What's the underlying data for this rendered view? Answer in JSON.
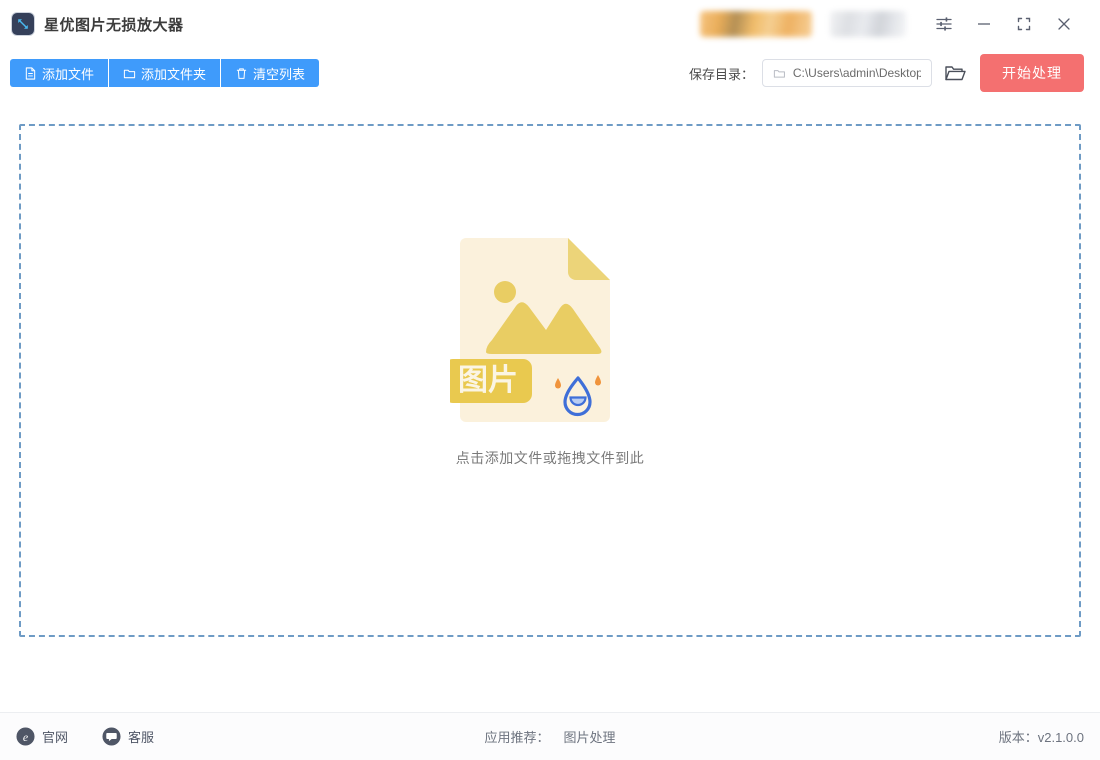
{
  "window": {
    "title": "星优图片无损放大器",
    "app_icon": "resize-arrows-icon",
    "controls": {
      "settings": "settings-sliders-icon",
      "minimize": "minimize-icon",
      "maximize": "maximize-icon",
      "close": "close-icon"
    }
  },
  "toolbar": {
    "buttons": [
      {
        "label": "添加文件",
        "icon": "file-icon"
      },
      {
        "label": "添加文件夹",
        "icon": "folder-icon"
      },
      {
        "label": "清空列表",
        "icon": "trash-icon"
      }
    ],
    "save_dir_label": "保存目录：",
    "save_dir_value": "C:\\Users\\admin\\Desktop",
    "save_dir_placeholder": "C:\\Users\\admin\\Desktop",
    "browse_icon": "open-folder-icon",
    "start_button": "开始处理"
  },
  "dropzone": {
    "hint": "点击添加文件或拖拽文件到此",
    "illustration_badge": "图片"
  },
  "footer": {
    "links": [
      {
        "label": "官网",
        "icon": "browser-e-icon"
      },
      {
        "label": "客服",
        "icon": "chat-bubble-icon"
      }
    ],
    "recommend_label": "应用推荐：",
    "recommend_items": [
      "图片处理"
    ],
    "version": "版本：v2.1.0.0"
  },
  "colors": {
    "primary_blue": "#3f9bfb",
    "accent_red": "#f47070",
    "dashed_border": "#6e9bc5",
    "icon_dark": "#4f5666",
    "doc_cream": "#fbf0d9",
    "doc_yellow": "#e9cd63",
    "drop_blue": "#3f6fd8"
  }
}
